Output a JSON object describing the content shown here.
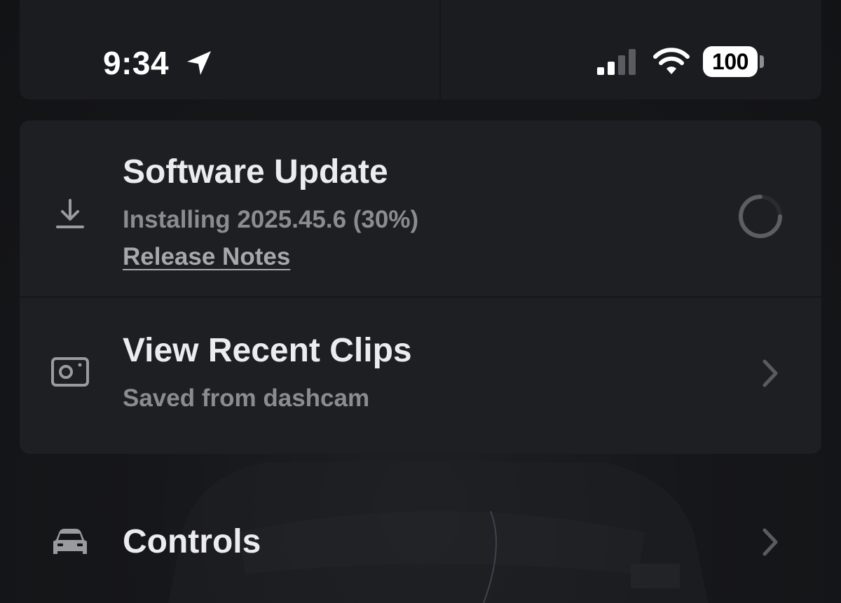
{
  "status_bar": {
    "time": "9:34",
    "battery_level": "100",
    "icons": [
      "location-arrow-icon",
      "cellular-signal-icon",
      "wifi-icon",
      "battery-icon"
    ],
    "signal_bars_active": 2,
    "signal_bars_total": 4
  },
  "software_update": {
    "title": "Software Update",
    "status": "Installing 2025.45.6 (30%)",
    "release_notes_label": "Release Notes",
    "icon": "download-icon",
    "progress_percent": 30
  },
  "recent_clips": {
    "title": "View Recent Clips",
    "subtitle": "Saved from dashcam",
    "icon": "dashcam-icon"
  },
  "controls": {
    "title": "Controls",
    "icon": "car-icon"
  },
  "colors": {
    "background": "#141517",
    "card": "#1e1f22",
    "title_text": "#ececee",
    "subtitle_text": "#8b8c90"
  }
}
